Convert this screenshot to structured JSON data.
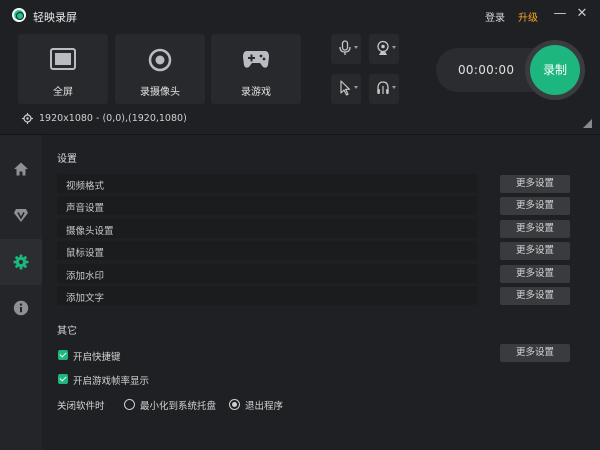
{
  "window": {
    "title": "轻映录屏",
    "login_label": "登录",
    "upgrade_label": "升级",
    "minimize_icon": "—",
    "close_icon": "✕",
    "accent_color": "#1cb67e",
    "upgrade_color": "#f5a623"
  },
  "modes": [
    {
      "label": "全屏",
      "icon": "fullscreen-icon"
    },
    {
      "label": "录摄像头",
      "icon": "webcam-icon"
    },
    {
      "label": "录游戏",
      "icon": "gamepad-icon"
    }
  ],
  "devices": {
    "microphone": "microphone-icon",
    "camera": "webcam-icon",
    "cursor": "cursor-icon",
    "audio": "headphones-icon"
  },
  "recorder": {
    "timer": "00:00:00",
    "record_label": "录制"
  },
  "capture": {
    "resolution_text": "1920x1080 - (0,0),(1920,1080)"
  },
  "sidebar": {
    "items": [
      {
        "name": "home",
        "icon": "home-icon",
        "active": false
      },
      {
        "name": "vip",
        "icon": "vip-icon",
        "active": false
      },
      {
        "name": "settings",
        "icon": "gear-icon",
        "active": true
      },
      {
        "name": "about",
        "icon": "info-icon",
        "active": false
      }
    ]
  },
  "settings": {
    "title": "设置",
    "more_label": "更多设置",
    "rows": [
      {
        "label": "视频格式"
      },
      {
        "label": "声音设置"
      },
      {
        "label": "摄像头设置"
      },
      {
        "label": "鼠标设置"
      },
      {
        "label": "添加水印"
      },
      {
        "label": "添加文字"
      }
    ]
  },
  "other": {
    "title": "其它",
    "more_label": "更多设置",
    "hotkey_label": "开启快捷键",
    "hotkey_checked": true,
    "fps_label": "开启游戏帧率显示",
    "fps_checked": true,
    "close_label": "关闭软件时",
    "close_options": [
      {
        "label": "最小化到系统托盘",
        "selected": false
      },
      {
        "label": "退出程序",
        "selected": true
      }
    ]
  }
}
